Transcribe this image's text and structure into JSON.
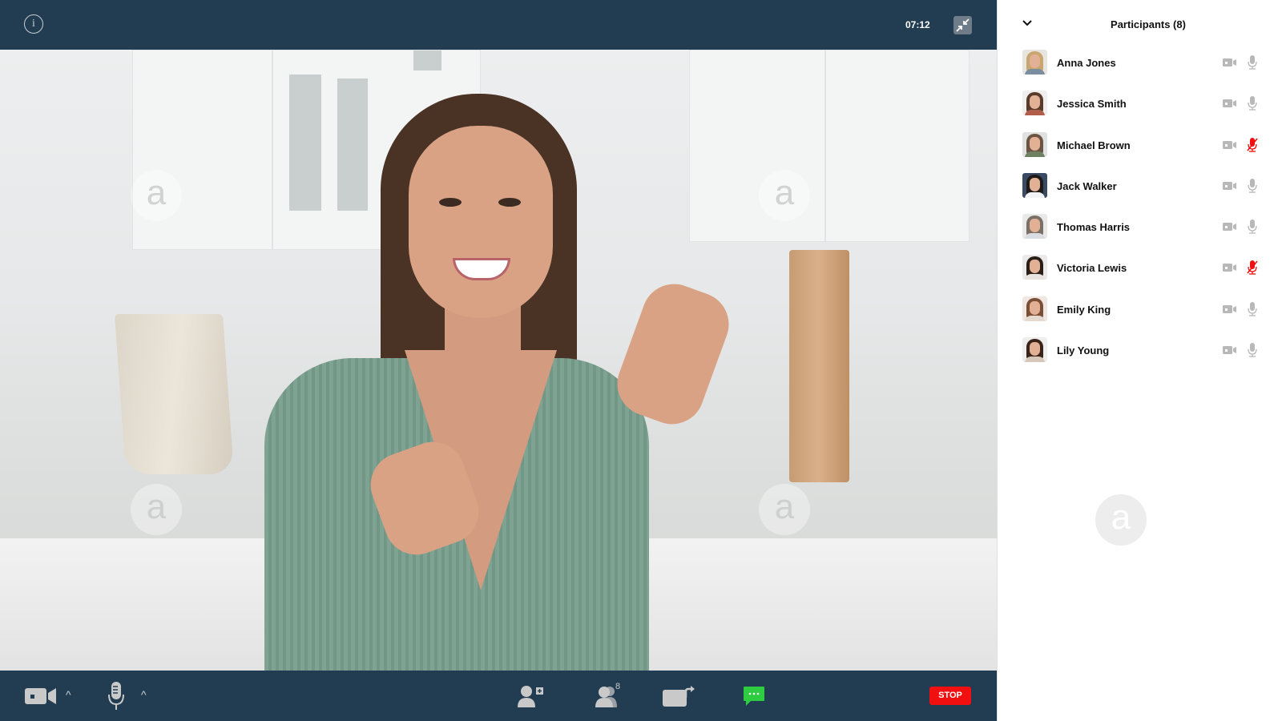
{
  "call": {
    "timer": "07:12",
    "info_icon": "info-icon",
    "shrink_icon": "exit-fullscreen-icon"
  },
  "toolbar": {
    "camera_icon": "video-camera-icon",
    "mic_icon": "microphone-icon",
    "invite_icon": "add-participant-icon",
    "participants_icon": "participants-icon",
    "participants_count": "8",
    "share_icon": "share-screen-icon",
    "chat_icon": "chat-icon",
    "stop_label": "STOP",
    "caret": "^"
  },
  "panel": {
    "title": "Participants  (8)",
    "collapse_icon": "chevron-down-icon",
    "participants": [
      {
        "name": "Anna Jones",
        "mic_muted": false,
        "hair": "#c9a56f",
        "bg": "#e8e4df",
        "body": "#7a8ea0"
      },
      {
        "name": "Jessica Smith",
        "mic_muted": false,
        "hair": "#5a3a2a",
        "bg": "#f1efed",
        "body": "#b05d4a"
      },
      {
        "name": "Michael Brown",
        "mic_muted": true,
        "hair": "#6b5444",
        "bg": "#dfe2e1",
        "body": "#6e7f62"
      },
      {
        "name": "Jack Walker",
        "mic_muted": false,
        "hair": "#1e1a18",
        "bg": "#3b4a63",
        "body": "#f2f4f7"
      },
      {
        "name": "Thomas Harris",
        "mic_muted": false,
        "hair": "#7b7068",
        "bg": "#e9e9e7",
        "body": "#d9dce0"
      },
      {
        "name": "Victoria Lewis",
        "mic_muted": true,
        "hair": "#2a1e18",
        "bg": "#eceae8",
        "body": "#e8e3de"
      },
      {
        "name": "Emily King",
        "mic_muted": false,
        "hair": "#7a4f35",
        "bg": "#f0e6e2",
        "body": "#e5d9d0"
      },
      {
        "name": "Lily Young",
        "mic_muted": false,
        "hair": "#3a2419",
        "bg": "#eeeeec",
        "body": "#d7c7ba"
      }
    ]
  },
  "colors": {
    "bar": "#223c52",
    "stop": "#f20f0f",
    "chat": "#2ecc40",
    "muted": "#f20f0f",
    "icon_gray": "#b8b8b8"
  }
}
